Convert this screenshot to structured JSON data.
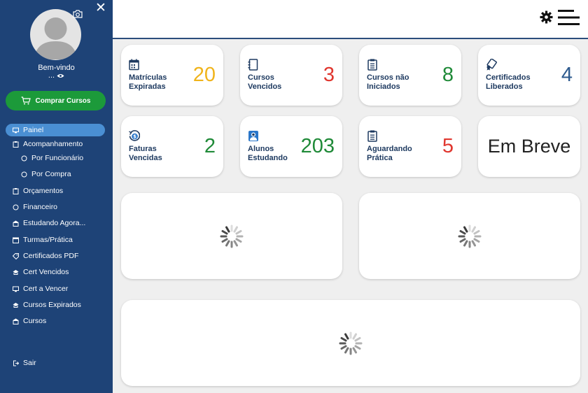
{
  "sidebar": {
    "welcome": "Bem-vindo",
    "welcome_sub": "...",
    "buy_button": "Comprar Cursos",
    "items": [
      {
        "label": "Painel",
        "icon": "monitor-icon"
      },
      {
        "label": "Acompanhamento",
        "icon": "clipboard-icon"
      },
      {
        "label": "Por Funcionário",
        "icon": "circle-icon"
      },
      {
        "label": "Por Compra",
        "icon": "circle-icon"
      },
      {
        "label": "Orçamentos",
        "icon": "clipboard-icon"
      },
      {
        "label": "Financeiro",
        "icon": "circle-icon"
      },
      {
        "label": "Estudando Agora...",
        "icon": "building-icon"
      },
      {
        "label": "Turmas/Prática",
        "icon": "calendar-icon"
      },
      {
        "label": "Certificados PDF",
        "icon": "tag-icon"
      },
      {
        "label": "Cert Vencidos",
        "icon": "cap-icon"
      },
      {
        "label": "Cert a Vencer",
        "icon": "monitor-icon"
      },
      {
        "label": "Cursos Expirados",
        "icon": "cap-icon"
      },
      {
        "label": "Cursos",
        "icon": "building-icon"
      },
      {
        "label": "Sair",
        "icon": "exit-icon"
      }
    ]
  },
  "cards": [
    {
      "label_1": "Matrículas",
      "label_2": "Expiradas",
      "value": "20",
      "color": "#f0b41c",
      "icon": "calendar-icon"
    },
    {
      "label_1": "Cursos",
      "label_2": "Vencidos",
      "value": "3",
      "color": "#e0372f",
      "icon": "notebook-icon"
    },
    {
      "label_1": "Cursos não",
      "label_2": "Iniciados",
      "value": "8",
      "color": "#1f8a38",
      "icon": "clipboard-list-icon"
    },
    {
      "label_1": "Certificados",
      "label_2": "Liberados",
      "value": "4",
      "color": "#2d5a8e",
      "icon": "diploma-icon"
    },
    {
      "label_1": "Faturas",
      "label_2": "Vencidas",
      "value": "2",
      "color": "#1f8a38",
      "icon": "dollar-clock-icon"
    },
    {
      "label_1": "Alunos",
      "label_2": "Estudando",
      "value": "203",
      "color": "#1f8a38",
      "icon": "student-icon"
    },
    {
      "label_1": "Aguardando",
      "label_2": "Prática",
      "value": "5",
      "color": "#e0372f",
      "icon": "clipboard-list-icon"
    }
  ],
  "soon_card": "Em Breve",
  "colors": {
    "sidebar": "#1e4377",
    "active": "#4a8fd3",
    "buy": "#1c9a3a"
  }
}
